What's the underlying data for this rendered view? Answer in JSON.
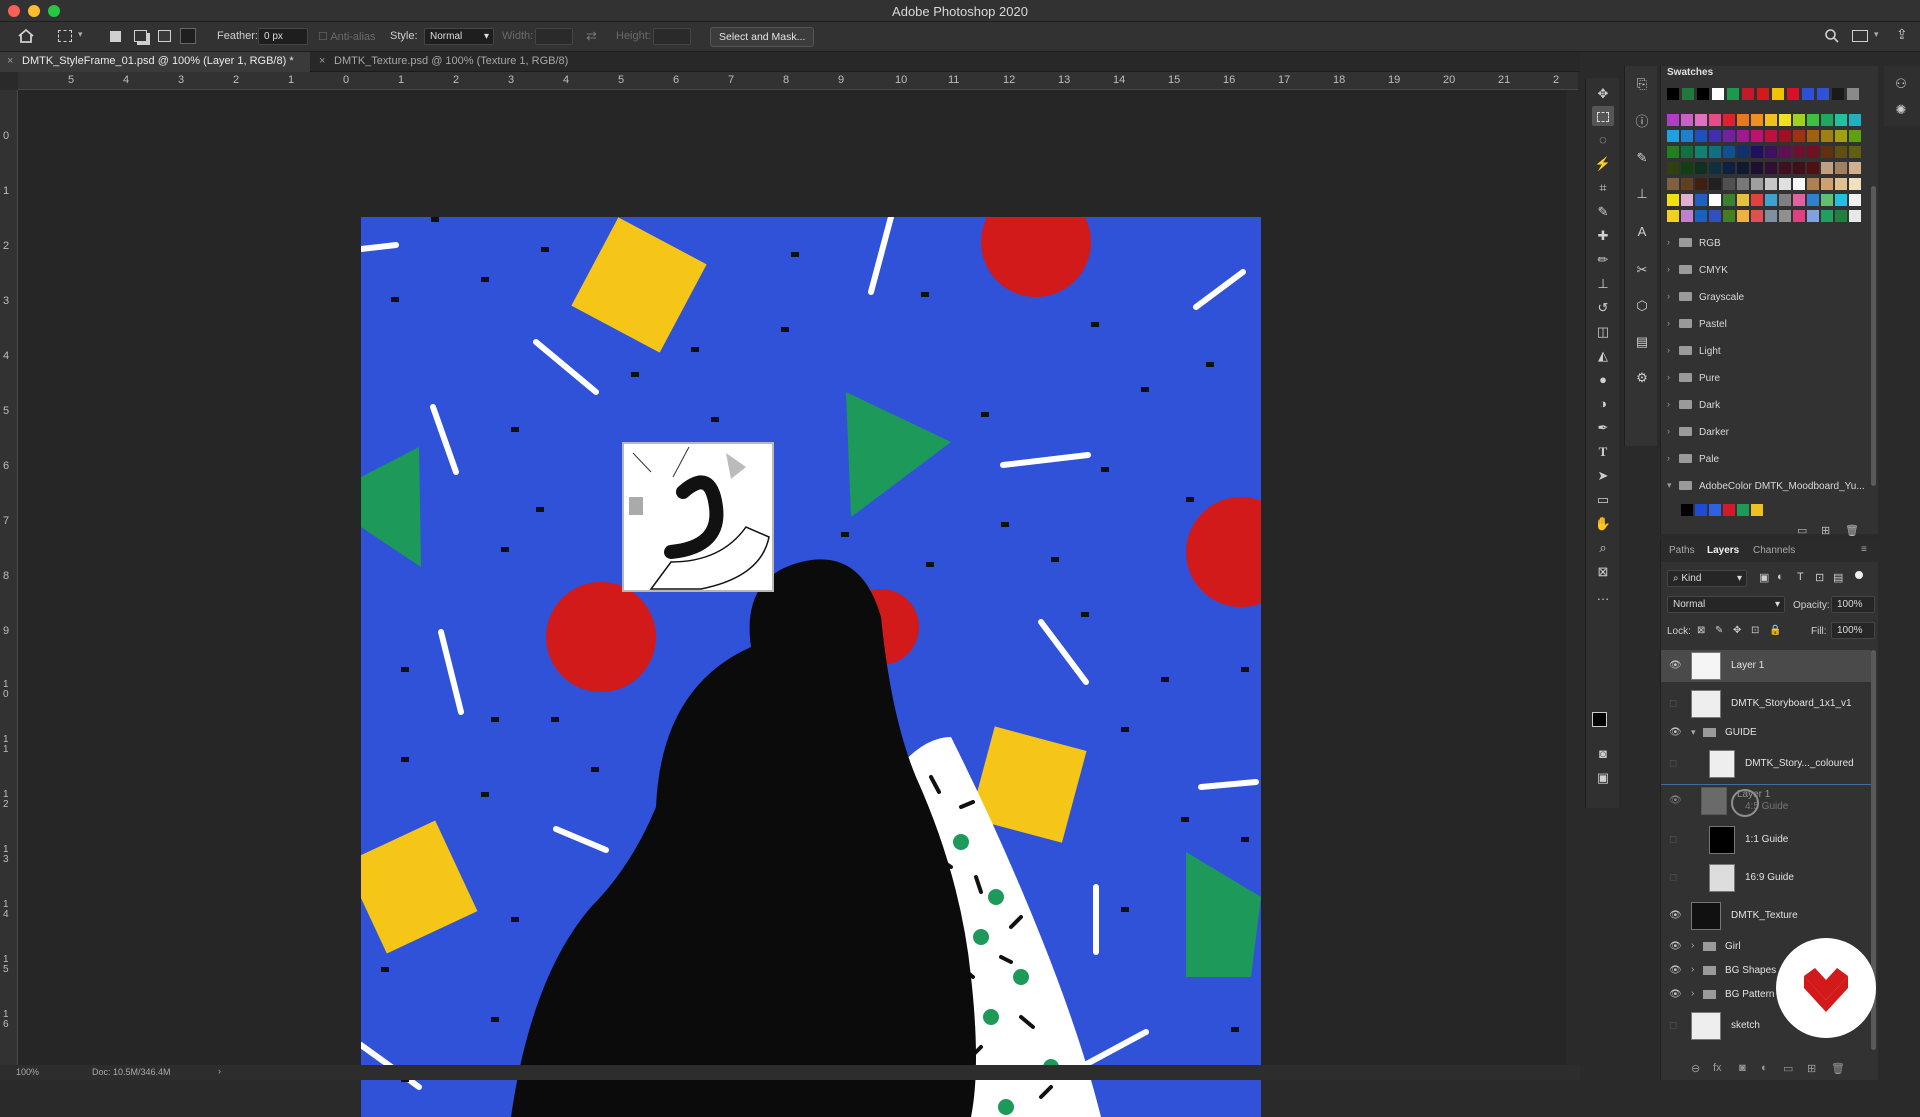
{
  "window": {
    "title": "Adobe Photoshop 2020"
  },
  "options_bar": {
    "feather_label": "Feather:",
    "feather_value": "0 px",
    "anti_alias_label": "Anti-alias",
    "style_label": "Style:",
    "style_value": "Normal",
    "width_label": "Width:",
    "height_label": "Height:",
    "select_mask_button": "Select and Mask..."
  },
  "tabs": [
    {
      "label": "DMTK_StyleFrame_01.psd @ 100% (Layer 1, RGB/8) *"
    },
    {
      "label": "DMTK_Texture.psd @ 100% (Texture 1, RGB/8)"
    }
  ],
  "ruler_h": [
    "5",
    "4",
    "3",
    "2",
    "1",
    "0",
    "1",
    "2",
    "3",
    "4",
    "5",
    "6",
    "7",
    "8",
    "9",
    "10",
    "11",
    "12",
    "13",
    "14",
    "15",
    "16",
    "17",
    "18",
    "19",
    "20",
    "21",
    "2"
  ],
  "ruler_v": [
    "0",
    "1",
    "2",
    "3",
    "4",
    "5",
    "6",
    "7",
    "8",
    "9",
    "1 0",
    "1 1",
    "1 2",
    "1 3",
    "1 4",
    "1 5",
    "1 6"
  ],
  "status": {
    "zoom": "100%",
    "doc": "Doc: 10.5M/346.4M"
  },
  "swatches": {
    "title": "Swatches",
    "recent": [
      "#000000",
      "#1e7a3c",
      "#000000",
      "#ffffff",
      "#1b9a4c",
      "#c21a2a",
      "#d21a1a",
      "#f0c200",
      "#d8102a",
      "#2c50d6",
      "#2f52d8",
      "#1a1a1a",
      "#8a8a8a"
    ],
    "grid": [
      [
        "#b03cc8",
        "#c860c8",
        "#e070c0",
        "#e84a8a",
        "#e02030",
        "#e87820",
        "#f09020",
        "#f0c020",
        "#f0e020",
        "#a0d020",
        "#40c040",
        "#20a860",
        "#20c0a0",
        "#20b0c0"
      ],
      [
        "#20a0e0",
        "#2080d0",
        "#2050c0",
        "#4030b0",
        "#7020a0",
        "#a01890",
        "#c01070",
        "#c01040",
        "#a01020",
        "#a03010",
        "#a06010",
        "#a08010",
        "#a0a010",
        "#60a010"
      ],
      [
        "#208020",
        "#107040",
        "#108070",
        "#107080",
        "#105090",
        "#103070",
        "#201060",
        "#401060",
        "#601050",
        "#701030",
        "#701020",
        "#603010",
        "#605010",
        "#606010"
      ],
      [
        "#304010",
        "#104010",
        "#103020",
        "#103040",
        "#102040",
        "#101a30",
        "#201030",
        "#301030",
        "#401020",
        "#401018",
        "#501010",
        "#c0a080",
        "#a08060",
        "#d0b090"
      ],
      [
        "#806040",
        "#604020",
        "#402010",
        "#202020",
        "#505050",
        "#787878",
        "#a0a0a0",
        "#c8c8c8",
        "#e0e0e0",
        "#f8f8f8",
        "#b08050",
        "#d0a070",
        "#e0c090",
        "#f0e0c0"
      ],
      [
        "#f0e010",
        "#e0b0d0",
        "#2060c0",
        "#ffffff",
        "#3a8030",
        "#e8c040",
        "#e04040",
        "#40a0d0",
        "#808080",
        "#e060a0",
        "#3080d0",
        "#60c070",
        "#20c0e0",
        "#f0f0f0"
      ],
      [
        "#f0d020",
        "#c080d0",
        "#1a60c0",
        "#3050c0",
        "#408020",
        "#f0b040",
        "#e05050",
        "#8090a0",
        "#909090",
        "#e04080",
        "#80a0e0",
        "#20a060",
        "#208040",
        "#e8e8e8"
      ]
    ],
    "folders": [
      "RGB",
      "CMYK",
      "Grayscale",
      "Pastel",
      "Light",
      "Pure",
      "Dark",
      "Darker",
      "Pale",
      "AdobeColor DMTK_Moodboard_Yu..."
    ],
    "moodboard": [
      "#000000",
      "#1e4ad8",
      "#2f62e0",
      "#d21a2a",
      "#1d9a5a",
      "#f0c020"
    ]
  },
  "layers_panel": {
    "tabs": [
      "Paths",
      "Layers",
      "Channels"
    ],
    "kind_label": "Kind",
    "blend_mode": "Normal",
    "opacity_label": "Opacity:",
    "opacity_value": "100%",
    "lock_label": "Lock:",
    "fill_label": "Fill:",
    "fill_value": "100%",
    "layers": [
      {
        "name": "Layer 1",
        "visible": true
      },
      {
        "name": "DMTK_Storyboard_1x1_v1",
        "visible": false
      },
      {
        "name": "GUIDE",
        "visible": true
      },
      {
        "name": "DMTK_Story..._coloured",
        "visible": false
      },
      {
        "name": "Layer 1",
        "visible": true
      },
      {
        "name": "1:1 Guide",
        "visible": false
      },
      {
        "name": "16:9 Guide",
        "visible": false
      },
      {
        "name": "DMTK_Texture",
        "visible": true
      },
      {
        "name": "Girl",
        "visible": true
      },
      {
        "name": "BG Shapes",
        "visible": true
      },
      {
        "name": "BG Pattern",
        "visible": true
      },
      {
        "name": "sketch",
        "visible": false
      }
    ],
    "drag_ghost": "4:5 Guide"
  },
  "colors": {
    "canvas_blue": "#2f52d8",
    "shape_red": "#d21a1a",
    "shape_yellow": "#f5c518",
    "shape_green": "#1d9a5a"
  }
}
